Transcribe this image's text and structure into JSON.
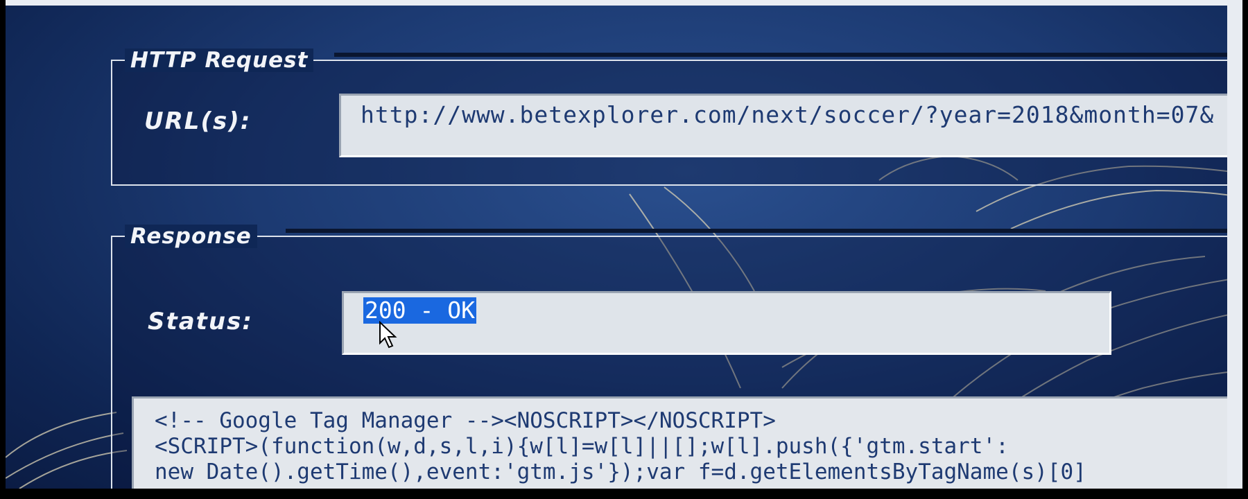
{
  "http_request": {
    "legend": "HTTP Request",
    "url_label": "URL(s):",
    "url_value": "http://www.betexplorer.com/next/soccer/?year=2018&month=07&"
  },
  "response": {
    "legend": "Response",
    "status_label": "Status:",
    "status_value": "200 - OK",
    "body_lines": [
      "<!-- Google Tag Manager --><NOSCRIPT></NOSCRIPT>",
      "<SCRIPT>(function(w,d,s,l,i){w[l]=w[l]||[];w[l].push({'gtm.start':",
      "new Date().getTime(),event:'gtm.js'});var f=d.getElementsByTagName(s)[0]"
    ]
  },
  "icons": {
    "cursor": "mouse-pointer-icon"
  },
  "colors": {
    "desktop": "#1c3a72",
    "field": "#dfe4ea",
    "text": "#1e3a72",
    "selection": "#1a68e0"
  }
}
